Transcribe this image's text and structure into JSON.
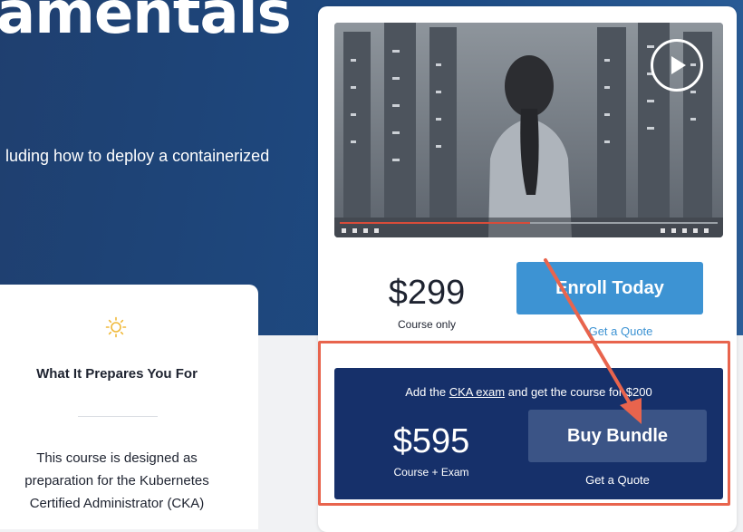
{
  "hero": {
    "title": "amentals",
    "subtitle": "luding how to deploy a containerized"
  },
  "prep_card": {
    "icon": "sun-icon",
    "title": "What It Prepares You For",
    "body_lines": [
      "This course is designed as",
      "preparation for the Kubernetes",
      "Certified Administrator (CKA)"
    ]
  },
  "video": {
    "play_icon": "play-icon"
  },
  "course": {
    "price": "$299",
    "price_note": "Course only",
    "enroll_label": "Enroll Today",
    "quote_label": "Get a Quote"
  },
  "bundle": {
    "offer_prefix": "Add the ",
    "offer_link": "CKA exam",
    "offer_suffix": " and get the course for $200",
    "price": "$595",
    "price_note": "Course + Exam",
    "buy_label": "Buy Bundle",
    "quote_label": "Get a Quote"
  },
  "colors": {
    "hero_blue": "#1d4a82",
    "enroll_blue": "#3d93d3",
    "bundle_navy": "#16306a",
    "annotation_orange": "#e8644d"
  }
}
